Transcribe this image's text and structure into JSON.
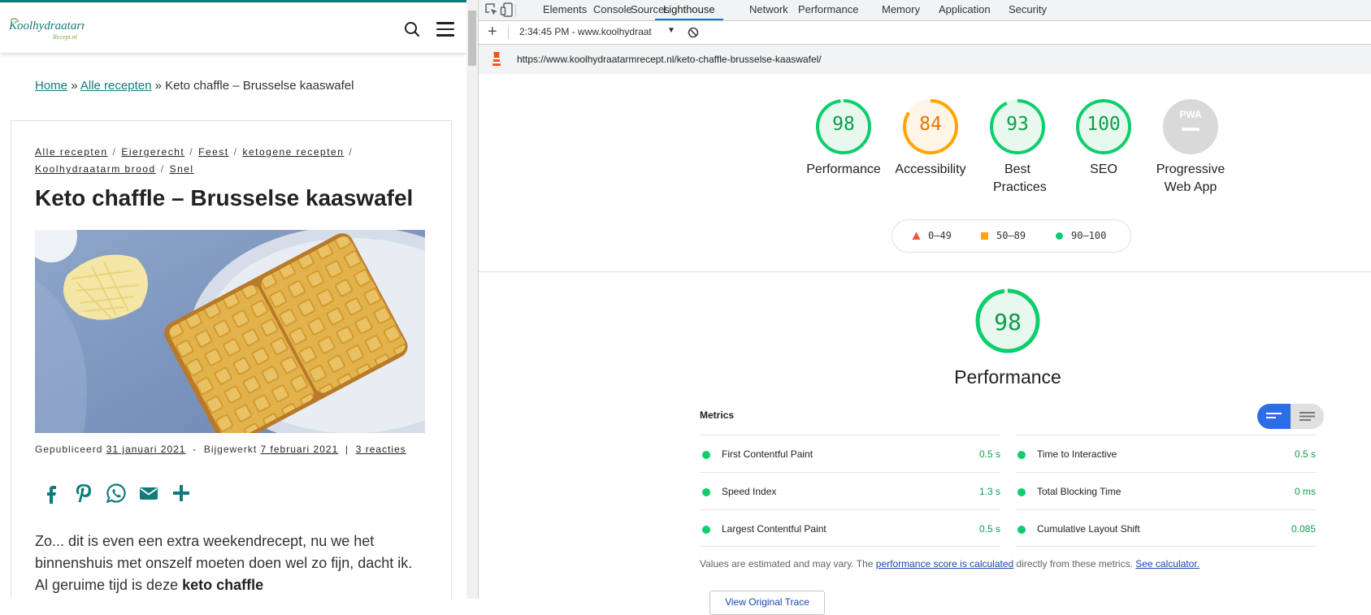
{
  "site": {
    "logo_text": "Koolhydraatarm",
    "logo_subtext": "Recept.nl",
    "breadcrumb": {
      "home": "Home",
      "sep": "»",
      "all_recipes": "Alle recepten",
      "current": "Keto chaffle – Brusselse kaaswafel"
    },
    "categories": [
      "Alle recepten",
      "Eiergerecht",
      "Feest",
      "ketogene recepten",
      "Koolhydraatarm brood",
      "Snel"
    ],
    "category_sep": "/",
    "title": "Keto chaffle – Brusselse kaaswafel",
    "meta": {
      "published_label": "Gepubliceerd",
      "published_date": "31 januari 2021",
      "dash": "-",
      "updated_label": "Bijgewerkt",
      "updated_date": "7 februari 2021",
      "pipe": "|",
      "comments": "3 reacties"
    },
    "share_icons": [
      "facebook-icon",
      "pinterest-icon",
      "whatsapp-icon",
      "email-icon",
      "plus-icon"
    ],
    "intro_text": "Zo... dit is even een extra weekendrecept, nu we het binnenshuis met onszelf moeten doen wel zo fijn, dacht ik. Al geruime tijd is deze ",
    "intro_bold": "keto chaffle",
    "brand_color": "#117a7a"
  },
  "devtools": {
    "tabs": [
      "Elements",
      "Console",
      "Sources",
      "Lighthouse",
      "Network",
      "Performance",
      "Memory",
      "Application",
      "Security"
    ],
    "active_tab": "Lighthouse",
    "toolbar": {
      "add": "+",
      "report_label": "2:34:45 PM - www.koolhydraat",
      "caret": "▼"
    },
    "url": "https://www.koolhydraatarmrecept.nl/keto-chaffle-brusselse-kaaswafel/",
    "gauges": [
      {
        "label": "Performance",
        "score": "98",
        "value": 0.98,
        "color": "#0cce6b",
        "text_color": "#0c9e4d",
        "bg": "#e8f8ee"
      },
      {
        "label": "Accessibility",
        "score": "84",
        "value": 0.84,
        "color": "#ffa400",
        "text_color": "#e67700",
        "bg": "#fff5e6"
      },
      {
        "label": "Best Practices",
        "score": "93",
        "value": 0.93,
        "color": "#0cce6b",
        "text_color": "#0c9e4d",
        "bg": "#e8f8ee"
      },
      {
        "label": "SEO",
        "score": "100",
        "value": 1.0,
        "color": "#0cce6b",
        "text_color": "#0c9e4d",
        "bg": "#e8f8ee"
      },
      {
        "label": "Progressive Web App",
        "score": "PWA",
        "value": 0,
        "color": "#cccccc",
        "text_color": "#ffffff",
        "bg": "#d9d9d9"
      }
    ],
    "legend": [
      {
        "range": "0–49",
        "shape": "triangle",
        "color": "#ff4e42"
      },
      {
        "range": "50–89",
        "shape": "square",
        "color": "#ffa400"
      },
      {
        "range": "90–100",
        "shape": "circle",
        "color": "#0cce6b"
      }
    ],
    "performance": {
      "score": "98",
      "value": 0.98,
      "title": "Performance",
      "metrics_heading": "Metrics",
      "metrics_left": [
        {
          "name": "First Contentful Paint",
          "value": "0.5 s"
        },
        {
          "name": "Speed Index",
          "value": "1.3 s"
        },
        {
          "name": "Largest Contentful Paint",
          "value": "0.5 s"
        }
      ],
      "metrics_right": [
        {
          "name": "Time to Interactive",
          "value": "0.5 s"
        },
        {
          "name": "Total Blocking Time",
          "value": "0 ms"
        },
        {
          "name": "Cumulative Layout Shift",
          "value": "0.085"
        }
      ],
      "note_prefix": "Values are estimated and may vary. The ",
      "note_link1": "performance score is calculated",
      "note_middle": " directly from these metrics. ",
      "note_link2": "See calculator.",
      "trace_button": "View Original Trace"
    }
  }
}
